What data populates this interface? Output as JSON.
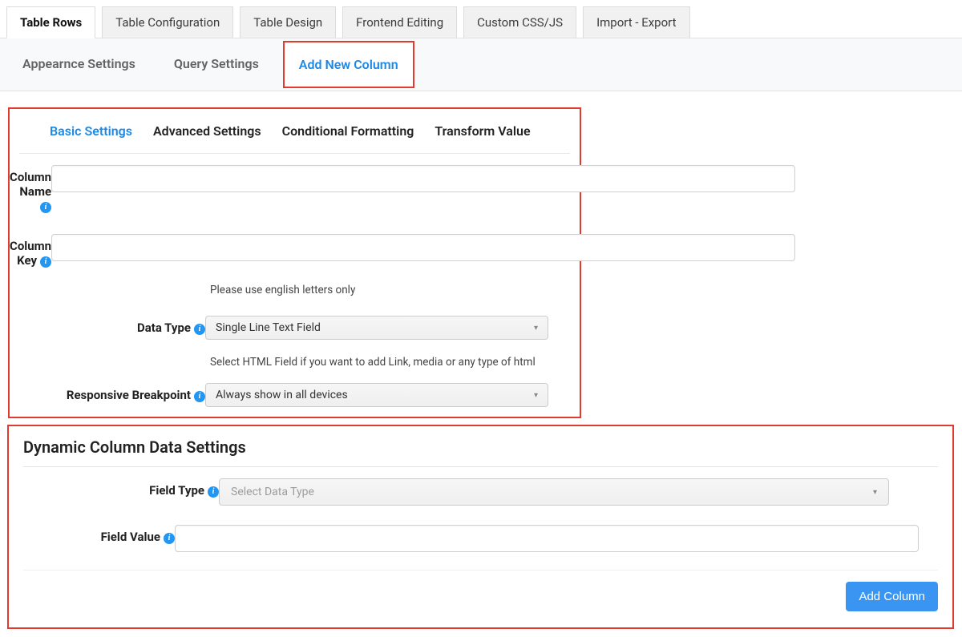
{
  "topTabs": {
    "rows": "Table Rows",
    "config": "Table Configuration",
    "design": "Table Design",
    "frontend": "Frontend Editing",
    "css": "Custom CSS/JS",
    "import": "Import - Export"
  },
  "subTabs": {
    "appearance": "Appearnce Settings",
    "query": "Query Settings",
    "addColumn": "Add New Column"
  },
  "innerTabs": {
    "basic": "Basic Settings",
    "advanced": "Advanced Settings",
    "conditional": "Conditional Formatting",
    "transform": "Transform Value"
  },
  "form": {
    "columnName": {
      "label": "Column Name",
      "value": ""
    },
    "columnKey": {
      "label": "Column Key",
      "value": "",
      "help": "Please use english letters only"
    },
    "dataType": {
      "label": "Data Type",
      "value": "Single Line Text Field",
      "help": "Select HTML Field if you want to add Link, media or any type of html"
    },
    "responsive": {
      "label": "Responsive Breakpoint",
      "value": "Always show in all devices"
    }
  },
  "dynamic": {
    "title": "Dynamic Column Data Settings",
    "fieldType": {
      "label": "Field Type",
      "placeholder": "Select Data Type"
    },
    "fieldValue": {
      "label": "Field Value",
      "value": ""
    },
    "button": "Add Column"
  }
}
